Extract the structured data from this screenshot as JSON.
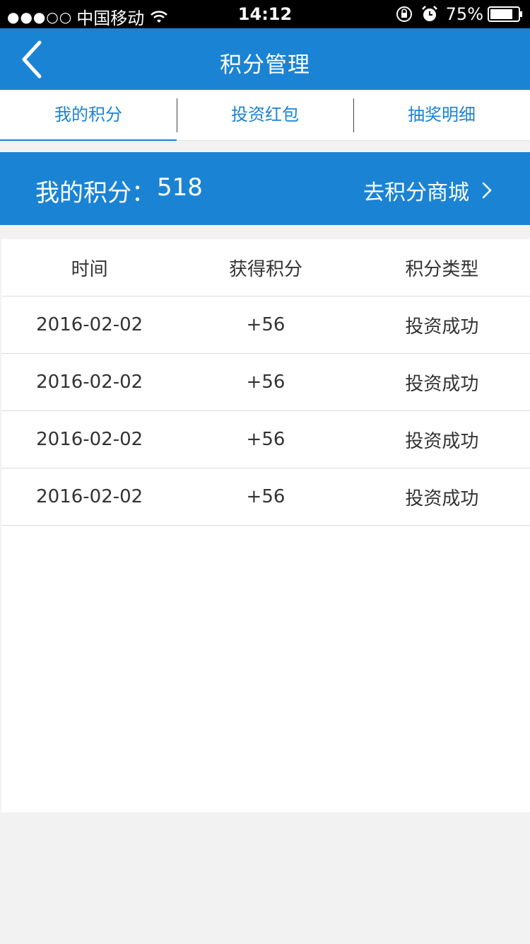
{
  "status_bar": {
    "signal": "●●●○○",
    "carrier": "中国移动",
    "time": "14:12",
    "battery": "75%"
  },
  "nav": {
    "title": "积分管理"
  },
  "tabs": [
    {
      "label": "我的积分"
    },
    {
      "label": "投资红包"
    },
    {
      "label": "抽奖明细"
    }
  ],
  "points": {
    "label": "我的积分：",
    "value": "518",
    "mall_link": "去积分商城"
  },
  "table": {
    "headers": [
      "时间",
      "获得积分",
      "积分类型"
    ],
    "rows": [
      [
        "2016-02-02",
        "+56",
        "投资成功"
      ],
      [
        "2016-02-02",
        "+56",
        "投资成功"
      ],
      [
        "2016-02-02",
        "+56",
        "投资成功"
      ],
      [
        "2016-02-02",
        "+56",
        "投资成功"
      ]
    ]
  },
  "colors": {
    "primary": "#1b83d4",
    "background": "#f3f2f3"
  }
}
